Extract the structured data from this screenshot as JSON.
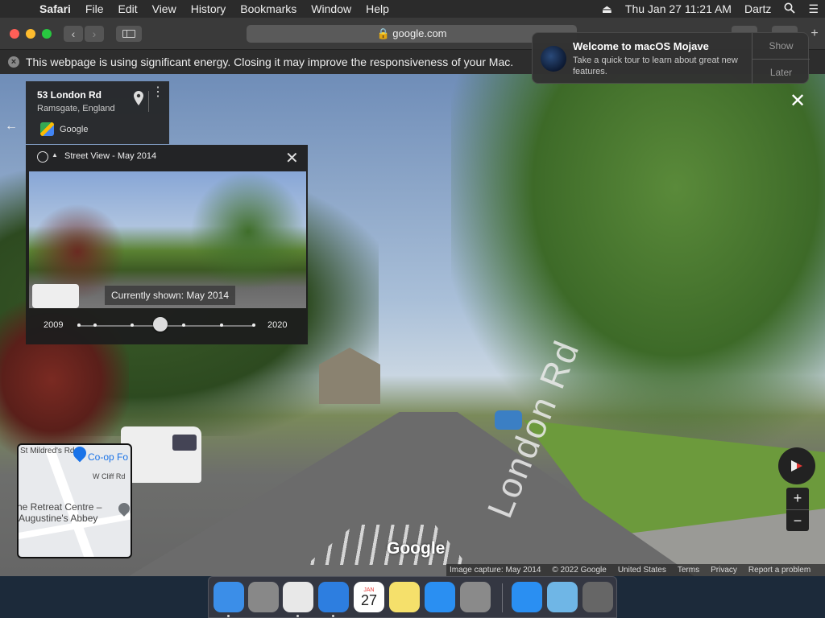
{
  "menubar": {
    "app_name": "Safari",
    "menus": [
      "File",
      "Edit",
      "View",
      "History",
      "Bookmarks",
      "Window",
      "Help"
    ],
    "clock": "Thu Jan 27  11:21 AM",
    "user": "Dartz"
  },
  "toolbar": {
    "url": "google.com"
  },
  "energy_banner": {
    "text": "This webpage is using significant energy. Closing it may improve the responsiveness of your Mac."
  },
  "notification": {
    "title": "Welcome to macOS Mojave",
    "body": "Take a quick tour to learn about great new features.",
    "show_label": "Show",
    "later_label": "Later"
  },
  "location_card": {
    "address": "53 London Rd",
    "city": "Ramsgate, England",
    "source": "Google"
  },
  "time_panel": {
    "title": "Street View - May 2014",
    "caption": "Currently shown: May 2014",
    "year_start": "2009",
    "year_end": "2020",
    "slider_position": 0.45
  },
  "street_view": {
    "road_label": "London Rd",
    "watermark": "Google"
  },
  "minimap": {
    "labels": {
      "st_mildreds": "St Mildred's Rd",
      "coop": "Co-op Fo",
      "w_cliff": "W Cliff Rd",
      "retreat_1": "he Retreat Centre –",
      "retreat_2": "Augustine's Abbey"
    }
  },
  "footer": {
    "capture": "Image capture: May 2014",
    "copyright": "© 2022 Google",
    "region": "United States",
    "terms": "Terms",
    "privacy": "Privacy",
    "report": "Report a problem"
  },
  "dock": {
    "items": [
      {
        "name": "finder-icon",
        "color": "#3b8ee8"
      },
      {
        "name": "launchpad-icon",
        "color": "#888888"
      },
      {
        "name": "chrome-icon",
        "color": "#e8e8e8"
      },
      {
        "name": "safari-icon",
        "color": "#2d7ee0"
      },
      {
        "name": "calendar-icon",
        "color": "#ffffff"
      },
      {
        "name": "notes-icon",
        "color": "#f5e06b"
      },
      {
        "name": "app-store-icon",
        "color": "#2a8ff2"
      },
      {
        "name": "system-preferences-icon",
        "color": "#8a8a8a"
      },
      {
        "name": "app-store-folder-icon",
        "color": "#2a8ff2"
      },
      {
        "name": "downloads-folder-icon",
        "color": "#6fb6e6"
      },
      {
        "name": "trash-icon",
        "color": "#666666"
      }
    ],
    "calendar_month": "JAN",
    "calendar_day": "27"
  }
}
